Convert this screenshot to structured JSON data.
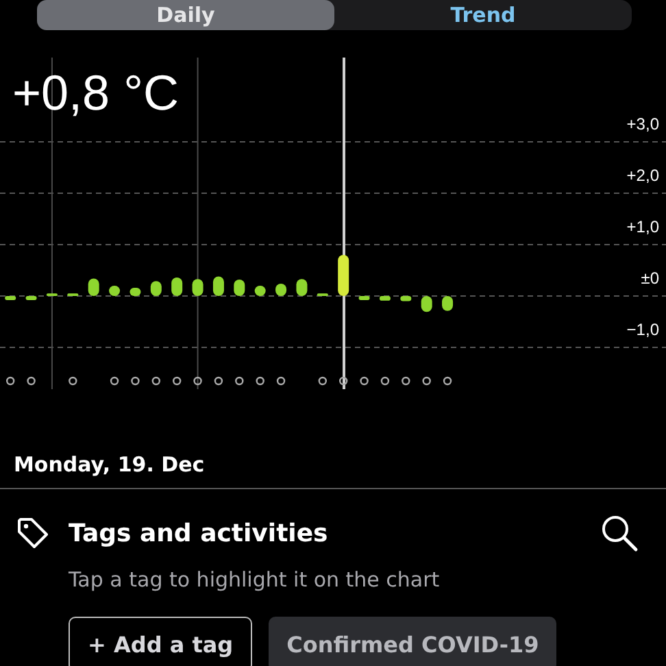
{
  "tabs": [
    {
      "label": "Daily",
      "selected": true
    },
    {
      "label": "Trend",
      "selected": false
    }
  ],
  "reading": "+0,8 °C",
  "chart": {
    "chart_data": {
      "type": "bar",
      "grid": true,
      "stacked": true,
      "series": [
        {
          "color": "#8ed62f",
          "values": [
            -0.08,
            -0.08,
            0.05,
            0.05,
            0.34,
            0.2,
            0.16,
            0.29,
            0.36,
            0.33,
            0.38,
            0.32,
            0.2,
            0.24,
            0.33,
            0.05,
            null,
            -0.08,
            -0.09,
            -0.1,
            -0.31,
            -0.29,
            null,
            null,
            null,
            null,
            null,
            null,
            null,
            null,
            null,
            null
          ]
        },
        {
          "color": "#d6ea3c",
          "values": [
            null,
            null,
            null,
            null,
            null,
            null,
            null,
            null,
            null,
            null,
            null,
            null,
            null,
            null,
            null,
            null,
            0.8,
            null,
            null,
            null,
            null,
            null,
            null,
            null,
            null,
            null,
            null,
            null,
            null,
            null,
            null,
            null
          ]
        }
      ],
      "ylim": [
        -7.2,
        5.76
      ],
      "yticks": [
        {
          "value": 3,
          "label": "+3,0"
        },
        {
          "value": 2,
          "label": "+2,0"
        },
        {
          "value": 1,
          "label": "+1,0"
        },
        {
          "value": 0,
          "label": "±0"
        },
        {
          "value": -1,
          "label": "−1,0"
        }
      ]
    },
    "days": [
      {
        "marker": true,
        "divider": false,
        "selected": false
      },
      {
        "marker": true,
        "divider": false,
        "selected": false
      },
      {
        "marker": false,
        "divider": true,
        "selected": false
      },
      {
        "marker": true,
        "divider": false,
        "selected": false
      },
      {
        "marker": false,
        "divider": false,
        "selected": false
      },
      {
        "marker": true,
        "divider": false,
        "selected": false
      },
      {
        "marker": true,
        "divider": false,
        "selected": false
      },
      {
        "marker": true,
        "divider": false,
        "selected": false
      },
      {
        "marker": true,
        "divider": false,
        "selected": false
      },
      {
        "marker": true,
        "divider": true,
        "selected": false
      },
      {
        "marker": true,
        "divider": false,
        "selected": false
      },
      {
        "marker": true,
        "divider": false,
        "selected": false
      },
      {
        "marker": true,
        "divider": false,
        "selected": false
      },
      {
        "marker": true,
        "divider": false,
        "selected": false
      },
      {
        "marker": false,
        "divider": false,
        "selected": false
      },
      {
        "marker": true,
        "divider": false,
        "selected": false
      },
      {
        "marker": true,
        "divider": false,
        "selected": true
      },
      {
        "marker": true,
        "divider": false,
        "selected": false
      },
      {
        "marker": true,
        "divider": false,
        "selected": false
      },
      {
        "marker": true,
        "divider": false,
        "selected": false
      },
      {
        "marker": true,
        "divider": false,
        "selected": false
      },
      {
        "marker": true,
        "divider": false,
        "selected": false
      }
    ]
  },
  "date": "Monday, 19. Dec",
  "tags": {
    "title": "Tags and activities",
    "hint": "Tap a tag to highlight it on the chart",
    "buttons": [
      {
        "label": "+ Add a tag",
        "kind": "outline"
      },
      {
        "label": "Confirmed COVID-19",
        "kind": "filled"
      }
    ]
  }
}
